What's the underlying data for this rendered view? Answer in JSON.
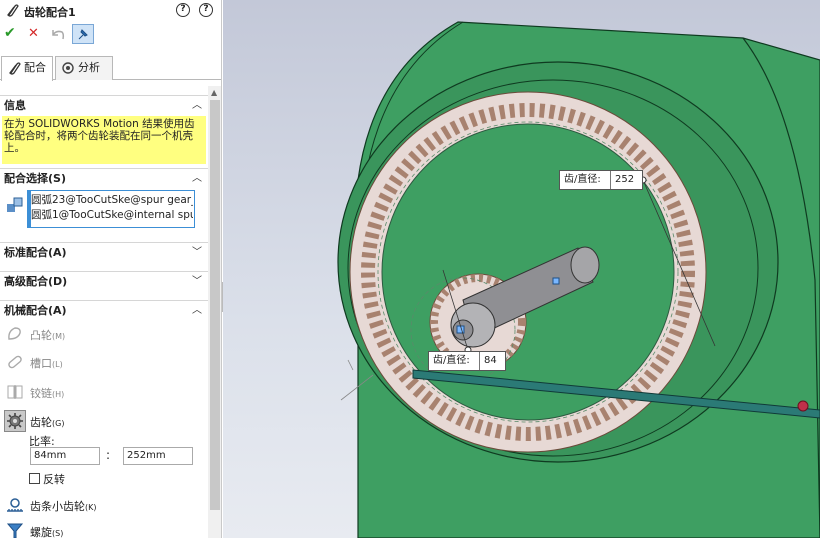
{
  "panel": {
    "title": "齿轮配合1",
    "help_q": "?",
    "help_circle": "?",
    "ok": "✔",
    "cancel": "✕",
    "tabs": [
      {
        "label": "配合",
        "active": true
      },
      {
        "label": "分析",
        "active": false
      }
    ]
  },
  "info": {
    "header": "信息",
    "text": "在为 SOLIDWORKS Motion 结果使用齿轮配合时，将两个齿轮装配在同一个机壳上。"
  },
  "selections": {
    "header": "配合选择(S)",
    "items": [
      "圆弧23@TooCutSke@spur gear_",
      "圆弧1@TooCutSke@internal spu"
    ]
  },
  "sections": {
    "standard": "标准配合(A)",
    "advanced": "高级配合(D)",
    "mechanical": "机械配合(A)"
  },
  "mechanical": {
    "items": [
      {
        "label": "凸轮",
        "key": "(M)"
      },
      {
        "label": "槽口",
        "key": "(L)"
      },
      {
        "label": "铰链",
        "key": "(H)"
      },
      {
        "label": "齿轮",
        "key": "(G)"
      },
      {
        "label": "齿条小齿轮",
        "key": "(K)"
      },
      {
        "label": "螺旋",
        "key": "(S)"
      }
    ],
    "ratio_label": "比率:",
    "ratio_a": "84mm",
    "ratio_sep": ":",
    "ratio_b": "252mm",
    "reverse_label": "反转"
  },
  "viewport": {
    "dim_large": {
      "label": "齿/直径:",
      "value": "252"
    },
    "dim_small": {
      "label": "齿/直径:",
      "value": "84"
    },
    "colors": {
      "housing": "#3e9f62",
      "ring": "#e7d9d5",
      "teeth": "#d7b9aa",
      "shaft": "#8f8f93",
      "rod": "#2b7a76"
    }
  }
}
